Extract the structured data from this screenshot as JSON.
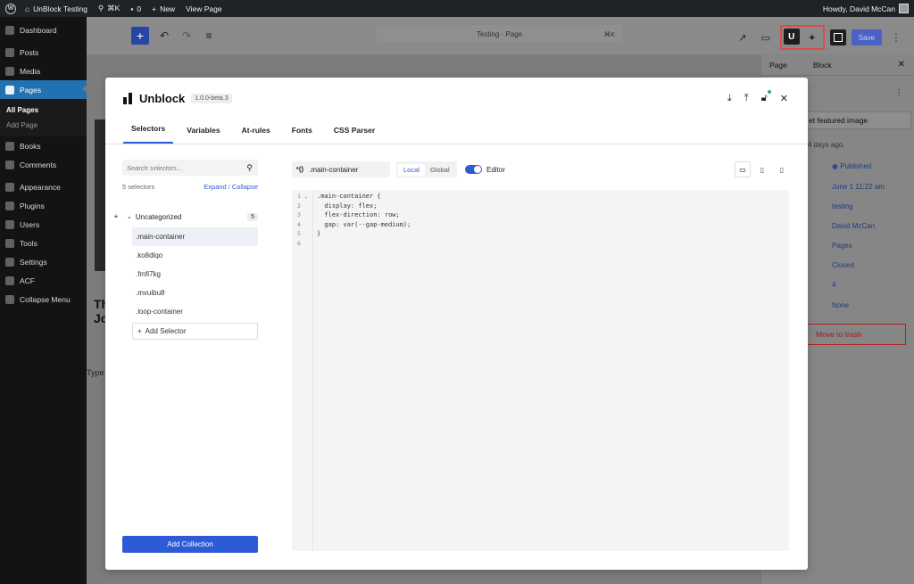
{
  "admin_bar": {
    "site_name": "UnBlock Testing",
    "command_shortcut": "⌘K",
    "comments_count": "0",
    "new_label": "New",
    "view_label": "View Page",
    "greeting": "Howdy, David McCan"
  },
  "sidebar": {
    "items": [
      {
        "label": "Dashboard",
        "icon": "dashboard-icon"
      },
      {
        "label": "Posts",
        "icon": "pin-icon"
      },
      {
        "label": "Media",
        "icon": "media-icon"
      },
      {
        "label": "Pages",
        "icon": "pages-icon"
      },
      {
        "label": "Books",
        "icon": "book-icon"
      },
      {
        "label": "Comments",
        "icon": "comment-icon"
      },
      {
        "label": "Appearance",
        "icon": "brush-icon"
      },
      {
        "label": "Plugins",
        "icon": "plugin-icon"
      },
      {
        "label": "Users",
        "icon": "users-icon"
      },
      {
        "label": "Tools",
        "icon": "wrench-icon"
      },
      {
        "label": "Settings",
        "icon": "settings-icon"
      },
      {
        "label": "ACF",
        "icon": "acf-icon"
      },
      {
        "label": "Collapse Menu",
        "icon": "collapse-icon"
      }
    ],
    "submenu": [
      "All Pages",
      "Add Page"
    ]
  },
  "editor_header": {
    "document_title": "Testing · Page",
    "document_shortcut": "⌘K",
    "save_label": "Save"
  },
  "canvas": {
    "title_line1": "Th",
    "title_line2": "Jo",
    "type_hint": "Type"
  },
  "settings_panel": {
    "tab_page": "Page",
    "tab_block": "Block",
    "featured_image_label": "et featured image",
    "modified": "4 days ago.",
    "status": "Published",
    "publish_date": "June 1 11:22 am",
    "slug": "testing",
    "author": "David McCan",
    "template": "Pages",
    "discussion": "Closed",
    "parent": "4",
    "none_label": "None",
    "trash_label": "Move to trash"
  },
  "modal": {
    "brand": "Unblock",
    "version": "1.0.0-beta.3",
    "tabs": [
      "Selectors",
      "Variables",
      "At-rules",
      "Fonts",
      "CSS Parser"
    ],
    "search_placeholder": "Search selectors...",
    "selector_count": "5 selectors",
    "expand_label": "Expand",
    "collapse_label": "Collapse",
    "group": {
      "name": "Uncategorized",
      "count": "5"
    },
    "selectors": [
      ".main-container",
      ".ko8dlqo",
      ".fmfi7kg",
      ".mvuibu8",
      ".loop-container"
    ],
    "add_selector_label": "Add Selector",
    "add_collection_label": "Add Collection",
    "current_selector": ".main-container",
    "scope_local": "Local",
    "scope_global": "Global",
    "editor_label": "Editor",
    "code_lines": [
      {
        "n": "1",
        "text": ".main-container {"
      },
      {
        "n": "2",
        "text": "  display: flex;"
      },
      {
        "n": "3",
        "text": "  flex-direction: row;"
      },
      {
        "n": "4",
        "text": "  gap: var(--gap-medium);"
      },
      {
        "n": "5",
        "text": "}"
      },
      {
        "n": "6",
        "text": ""
      }
    ]
  },
  "colors": {
    "accent": "#2d5bd7",
    "highlight": "#e24a4a",
    "admin_bar": "#1d2327",
    "sidebar": "#131313"
  }
}
